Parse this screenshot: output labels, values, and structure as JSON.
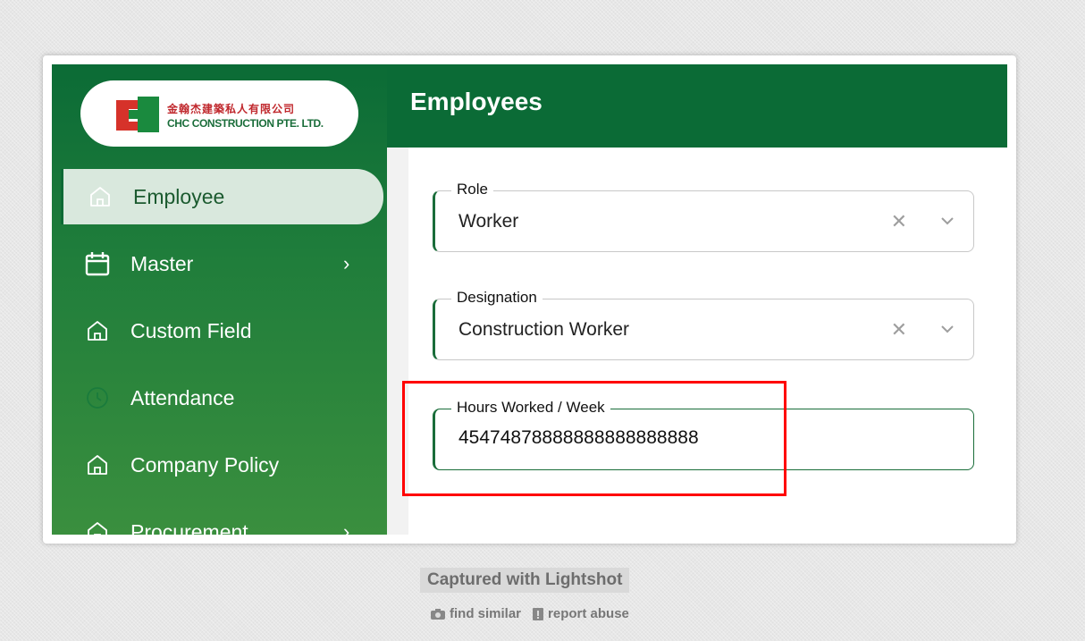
{
  "app": {
    "logo": {
      "chinese_name": "金翰杰建築私人有限公司",
      "english_name": "CHC CONSTRUCTION PTE. LTD."
    },
    "header": {
      "title": "Employees"
    },
    "sidebar": {
      "items": [
        {
          "label": "Employee",
          "icon": "home-icon",
          "active": true
        },
        {
          "label": "Master",
          "icon": "calendar-icon",
          "has_submenu": true
        },
        {
          "label": "Custom Field",
          "icon": "home-icon"
        },
        {
          "label": "Attendance",
          "icon": "clock-icon"
        },
        {
          "label": "Company Policy",
          "icon": "home-icon"
        },
        {
          "label": "Procurement",
          "icon": "home-icon",
          "has_submenu": true
        }
      ]
    },
    "form": {
      "role": {
        "label": "Role",
        "value": "Worker"
      },
      "designation": {
        "label": "Designation",
        "value": "Construction Worker"
      },
      "hours": {
        "label": "Hours Worked / Week",
        "value": "45474878888888888888888"
      }
    }
  },
  "lightshot": {
    "caption": "Captured with Lightshot",
    "find_similar": "find similar",
    "report_abuse": "report abuse"
  },
  "colors": {
    "primary": "#0b6b36",
    "active_item_bg": "#d9e8dd",
    "highlight": "#ff0000"
  }
}
